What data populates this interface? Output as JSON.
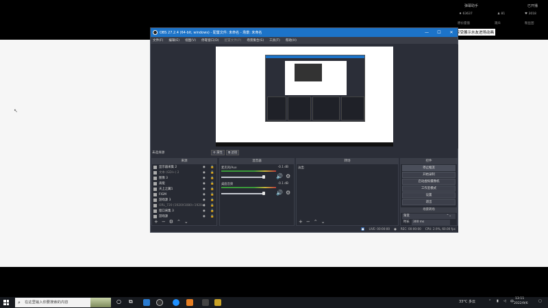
{
  "overlay": {
    "stream_title": "弹幕助手",
    "live_status": "已开播",
    "stats": [
      "63637",
      "81",
      "3018"
    ],
    "stat_labels": [
      "原价座值",
      "观众",
      "粉丝团"
    ],
    "chat_message": "享受展示水友进场动画"
  },
  "obs": {
    "title": "OBS 27.2.4 (64-bit, windows) - 配置文件: 未命名 - 场景: 未命名",
    "menu": [
      "文件(F)",
      "编辑(E)",
      "视图(V)",
      "停靠窗口(D)",
      "配置文件(P)",
      "场景集合(S)",
      "工具(T)",
      "帮助(H)"
    ],
    "scene_label": "未选择源",
    "properties_label": "属性",
    "filters_label": "滤镜",
    "docks": {
      "sources": "来源",
      "mixer": "混音器",
      "transitions": "转场",
      "controls": "控件"
    },
    "sources": [
      {
        "name": "显示器采集 2",
        "dim": false
      },
      {
        "name": "文本 (GDI+) 2",
        "dim": true
      },
      {
        "name": "图像 3",
        "dim": false
      },
      {
        "name": "高能",
        "dim": false
      },
      {
        "name": "天上之翼1",
        "dim": false
      },
      {
        "name": "FIGM",
        "dim": false
      },
      {
        "name": "游戏源 3",
        "dim": false
      },
      {
        "name": "ORL_720 (1920X1080+1920x)",
        "dim": true
      },
      {
        "name": "窗口采集 3",
        "dim": false
      },
      {
        "name": "游戏源",
        "dim": false
      }
    ],
    "mixer": [
      {
        "name": "麦克风/Aux",
        "db": "-0.1 dB"
      },
      {
        "name": "桌面音频",
        "db": "-0.1 dB"
      }
    ],
    "transition_label": "淡出",
    "transition_type": "渐变",
    "duration_label": "时长",
    "duration_value": "300 ms",
    "controls": [
      "停止推流",
      "开始录制",
      "启动虚拟摄像机",
      "工作室模式",
      "设置",
      "退出"
    ],
    "studio_mode_label": "场景转场",
    "status": {
      "live": "LIVE: 00:00:00",
      "rec": "REC: 00:00:00",
      "cpu": "CPU: 2.9%, 60.00 fps"
    }
  },
  "taskbar": {
    "search_placeholder": "在这里输入你要搜索的内容",
    "weather": "33°C 多云",
    "time": "13:11",
    "date": "2022/9/6",
    "ime": "中"
  }
}
